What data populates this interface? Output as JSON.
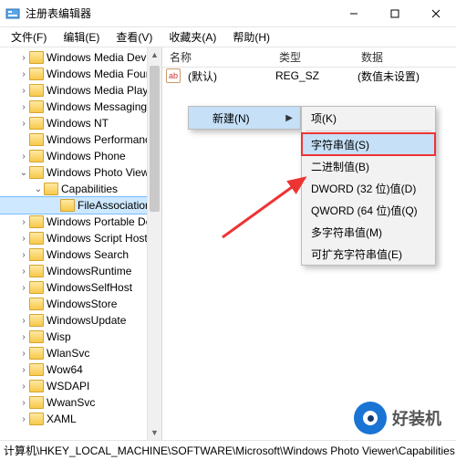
{
  "window": {
    "title": "注册表编辑器"
  },
  "menubar": {
    "file": "文件(F)",
    "edit": "编辑(E)",
    "view": "查看(V)",
    "favorites": "收藏夹(A)",
    "help": "帮助(H)"
  },
  "tree": {
    "items": [
      {
        "label": "Windows Media Device",
        "depth": 1,
        "exp": ">"
      },
      {
        "label": "Windows Media Found",
        "depth": 1,
        "exp": ">"
      },
      {
        "label": "Windows Media Player",
        "depth": 1,
        "exp": ">"
      },
      {
        "label": "Windows Messaging S",
        "depth": 1,
        "exp": ">"
      },
      {
        "label": "Windows NT",
        "depth": 1,
        "exp": ">"
      },
      {
        "label": "Windows Performance",
        "depth": 1,
        "exp": ""
      },
      {
        "label": "Windows Phone",
        "depth": 1,
        "exp": ">"
      },
      {
        "label": "Windows Photo Viewer",
        "depth": 1,
        "exp": "v"
      },
      {
        "label": "Capabilities",
        "depth": 2,
        "exp": "v"
      },
      {
        "label": "FileAssociations",
        "depth": 3,
        "exp": "",
        "selected": true
      },
      {
        "label": "Windows Portable Dev",
        "depth": 1,
        "exp": ">"
      },
      {
        "label": "Windows Script Host",
        "depth": 1,
        "exp": ">"
      },
      {
        "label": "Windows Search",
        "depth": 1,
        "exp": ">"
      },
      {
        "label": "WindowsRuntime",
        "depth": 1,
        "exp": ">"
      },
      {
        "label": "WindowsSelfHost",
        "depth": 1,
        "exp": ">"
      },
      {
        "label": "WindowsStore",
        "depth": 1,
        "exp": ""
      },
      {
        "label": "WindowsUpdate",
        "depth": 1,
        "exp": ">"
      },
      {
        "label": "Wisp",
        "depth": 1,
        "exp": ">"
      },
      {
        "label": "WlanSvc",
        "depth": 1,
        "exp": ">"
      },
      {
        "label": "Wow64",
        "depth": 1,
        "exp": ">"
      },
      {
        "label": "WSDAPI",
        "depth": 1,
        "exp": ">"
      },
      {
        "label": "WwanSvc",
        "depth": 1,
        "exp": ">"
      },
      {
        "label": "XAML",
        "depth": 1,
        "exp": ">"
      }
    ]
  },
  "list": {
    "header": {
      "name": "名称",
      "type": "类型",
      "data": "数据"
    },
    "row": {
      "icon": "ab",
      "name": "(默认)",
      "type": "REG_SZ",
      "data": "(数值未设置)"
    }
  },
  "ctx_new": {
    "parent_label": "新建(N)",
    "items": [
      {
        "label": "项(K)"
      },
      {
        "label": "字符串值(S)",
        "highlight": true
      },
      {
        "label": "二进制值(B)"
      },
      {
        "label": "DWORD (32 位)值(D)"
      },
      {
        "label": "QWORD (64 位)值(Q)"
      },
      {
        "label": "多字符串值(M)"
      },
      {
        "label": "可扩充字符串值(E)"
      }
    ]
  },
  "status": {
    "path": "计算机\\HKEY_LOCAL_MACHINE\\SOFTWARE\\Microsoft\\Windows Photo Viewer\\Capabilities"
  },
  "watermark": {
    "text": "好装机"
  }
}
